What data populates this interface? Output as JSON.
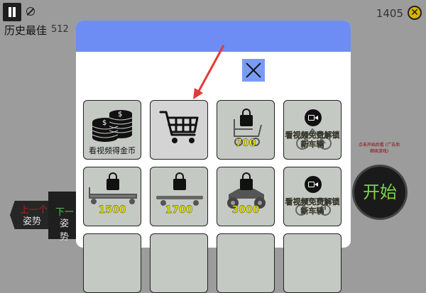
{
  "hud": {
    "best_label": "历史最佳",
    "best_value": "512",
    "coins": "1405"
  },
  "start_label": "开始",
  "side_hint": "点击开始后看 (广告后继续游戏)",
  "pose": {
    "prev_line1": "上一个",
    "prev_line2": "姿势",
    "next_line1": "下一",
    "next_line2": "姿势"
  },
  "shop": {
    "cards": [
      {
        "name": "watch-video-coins",
        "label": "看视频得金币",
        "kind": "coins",
        "locked": false
      },
      {
        "name": "shopping-cart",
        "label": "",
        "kind": "cart",
        "locked": false,
        "selected": true
      },
      {
        "name": "wheelchair",
        "label": "700",
        "kind": "price",
        "locked": true
      },
      {
        "name": "video-unlock-1",
        "label": "看视频免费解锁新车辆",
        "kind": "video",
        "locked": true
      },
      {
        "name": "flatbed-cart",
        "label": "1500",
        "kind": "price",
        "locked": true
      },
      {
        "name": "skateboard-board",
        "label": "1700",
        "kind": "price",
        "locked": true
      },
      {
        "name": "atv-quad",
        "label": "3000",
        "kind": "price",
        "locked": true
      },
      {
        "name": "video-unlock-2",
        "label": "看视频免费解锁新车辆",
        "kind": "video",
        "locked": true
      }
    ]
  },
  "colors": {
    "header": "#6d8df4",
    "price_text": "#e6e600",
    "start_text": "#7fd14e",
    "arrow": "#e53935"
  }
}
